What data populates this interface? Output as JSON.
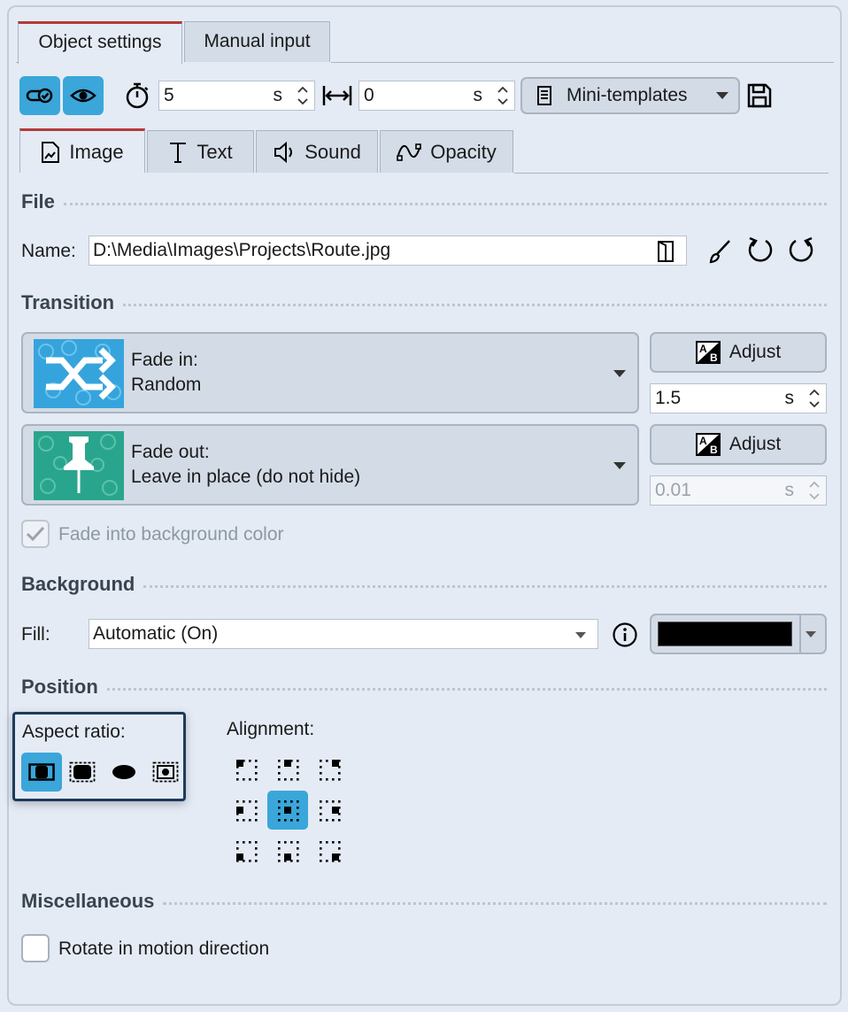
{
  "tabs": {
    "object_settings": "Object settings",
    "manual_input": "Manual input"
  },
  "toolbar": {
    "duration_value": "5",
    "duration_unit": "s",
    "offset_value": "0",
    "offset_unit": "s",
    "mini_templates": "Mini-templates"
  },
  "inner_tabs": {
    "image": "Image",
    "text": "Text",
    "sound": "Sound",
    "opacity": "Opacity"
  },
  "file": {
    "section": "File",
    "name_label": "Name:",
    "name_value": "D:\\Media\\Images\\Projects\\Route.jpg"
  },
  "transition": {
    "section": "Transition",
    "fade_in_label": "Fade in:",
    "fade_in_value": "Random",
    "fade_in_adjust": "Adjust",
    "fade_in_duration": "1.5",
    "fade_in_unit": "s",
    "fade_out_label": "Fade out:",
    "fade_out_value": "Leave in place (do not hide)",
    "fade_out_adjust": "Adjust",
    "fade_out_duration": "0.01",
    "fade_out_unit": "s",
    "fade_bg_label": "Fade into background color"
  },
  "background": {
    "section": "Background",
    "fill_label": "Fill:",
    "fill_value": "Automatic (On)",
    "color": "#000000"
  },
  "position": {
    "section": "Position",
    "aspect_label": "Aspect ratio:",
    "alignment_label": "Alignment:"
  },
  "misc": {
    "section": "Miscellaneous",
    "rotate_label": "Rotate in motion direction"
  },
  "colors": {
    "accent": "#3aa6da",
    "tab_marker": "#b53a3a",
    "focus_border": "#1d3a5a"
  }
}
